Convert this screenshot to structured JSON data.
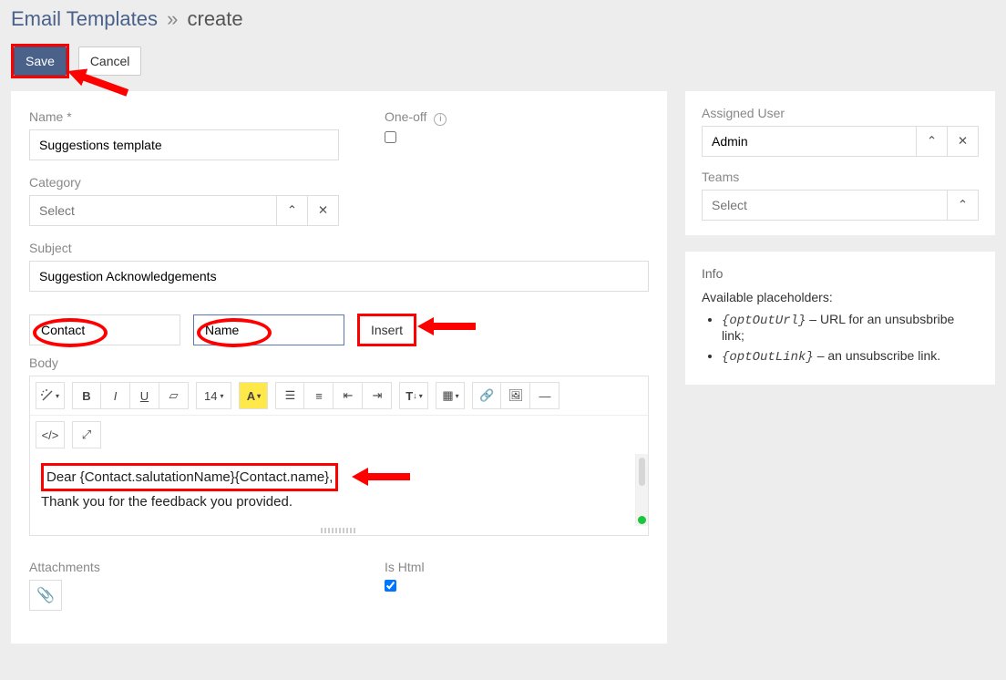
{
  "breadcrumb": {
    "root": "Email Templates",
    "separator": "»",
    "current": "create"
  },
  "toolbar": {
    "save": "Save",
    "cancel": "Cancel"
  },
  "fields": {
    "name_label": "Name *",
    "name_value": "Suggestions template",
    "oneoff_label": "One-off",
    "category_label": "Category",
    "category_placeholder": "Select",
    "subject_label": "Subject",
    "subject_value": "Suggestion Acknowledgements",
    "body_label": "Body",
    "attachments_label": "Attachments",
    "ishtml_label": "Is Html"
  },
  "insert": {
    "entity_selected": "Contact",
    "field_selected": "Name",
    "button": "Insert"
  },
  "editor_toolbar": {
    "magic": "⚡",
    "bold": "B",
    "italic": "I",
    "underline": "U",
    "clear": "⌫",
    "size": "14",
    "fontcolor": "A",
    "ul": "≣",
    "ol": "≡",
    "indent": "⇥",
    "outdent": "⇤",
    "heading": "T",
    "table": "▦",
    "link": "🔗",
    "image": "🖼",
    "hr": "—",
    "code": "</>",
    "fullscreen": "⤢"
  },
  "body": {
    "line1": "Dear {Contact.salutationName}{Contact.name},",
    "line2": "Thank you for the feedback you provided."
  },
  "side": {
    "assigned_label": "Assigned User",
    "assigned_value": "Admin",
    "teams_label": "Teams",
    "teams_placeholder": "Select"
  },
  "info": {
    "heading": "Info",
    "intro": "Available placeholders:",
    "items": [
      {
        "code": "{optOutUrl}",
        "desc": " – URL for an unsubsbribe link;"
      },
      {
        "code": "{optOutLink}",
        "desc": " – an unsubscribe link."
      }
    ]
  }
}
